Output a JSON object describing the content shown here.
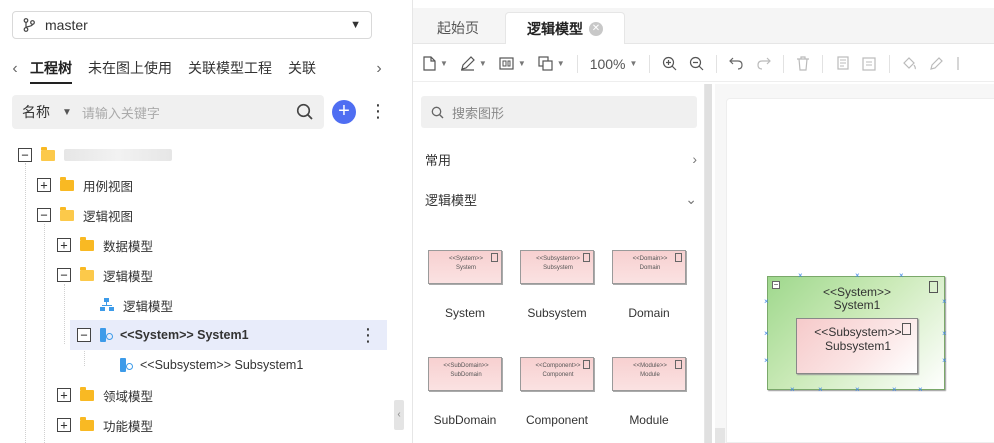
{
  "branch": {
    "name": "master"
  },
  "left_tabs": [
    "工程树",
    "未在图上使用",
    "关联模型工程",
    "关联"
  ],
  "left_search": {
    "field": "名称",
    "placeholder": "请输入关键字"
  },
  "tree": {
    "items": [
      {
        "label": "用例视图"
      },
      {
        "label": "逻辑视图"
      },
      {
        "label": "数据模型"
      },
      {
        "label": "逻辑模型"
      },
      {
        "label": "逻辑模型"
      },
      {
        "label": "<<System>> System1"
      },
      {
        "label": "<<Subsystem>> Subsystem1"
      },
      {
        "label": "领域模型"
      },
      {
        "label": "功能模型"
      }
    ]
  },
  "editor_tabs": [
    {
      "label": "起始页"
    },
    {
      "label": "逻辑模型"
    }
  ],
  "toolbar": {
    "zoom": "100%"
  },
  "shape_panel": {
    "search_placeholder": "搜索图形",
    "categories": [
      {
        "label": "常用"
      },
      {
        "label": "逻辑模型"
      }
    ],
    "shapes": [
      {
        "stereo": "<<System>>",
        "inner": "System",
        "name": "System"
      },
      {
        "stereo": "<<Subsystem>>",
        "inner": "Subsystem",
        "name": "Subsystem"
      },
      {
        "stereo": "<<Domain>>",
        "inner": "Domain",
        "name": "Domain"
      },
      {
        "stereo": "<<SubDomain>>",
        "inner": "SubDomain",
        "name": "SubDomain"
      },
      {
        "stereo": "<<Component>>",
        "inner": "Component",
        "name": "Component"
      },
      {
        "stereo": "<<Module>>",
        "inner": "Module",
        "name": "Module"
      }
    ]
  },
  "canvas": {
    "system": {
      "stereo": "<<System>>",
      "name": "System1"
    },
    "subsystem": {
      "stereo": "<<Subsystem>>",
      "name": "Subsystem1"
    }
  },
  "colors": {
    "accent": "#4f6ef2",
    "selected_row": "#e8ecfa",
    "folder": "#f9b923",
    "node_icon": "#3d9be9"
  }
}
